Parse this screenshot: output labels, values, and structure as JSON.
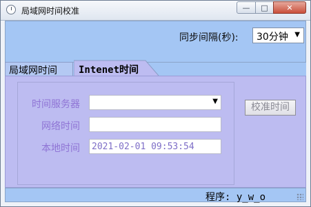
{
  "window": {
    "title": "局域网时间校准"
  },
  "titlebar_buttons": {
    "minimize": "—",
    "maximize": "□",
    "close": "✕"
  },
  "top": {
    "interval_label": "同步间隔(秒):",
    "interval_value": "30分钟"
  },
  "tabs": [
    {
      "label": "局域网时间"
    },
    {
      "label": "Intenet时间"
    }
  ],
  "form": {
    "server_label": "时间服务器",
    "server_value": "",
    "network_label": "网络时间",
    "network_value": "",
    "local_label": "本地时间",
    "local_value": "2021-02-01 09:53:54",
    "calibrate_label": "校准时间"
  },
  "status": {
    "text": "程序: y_w_o"
  },
  "icons": {
    "app": "clock-icon",
    "dropdown": "chevron-down-icon",
    "grip": "resize-grip-icon"
  }
}
